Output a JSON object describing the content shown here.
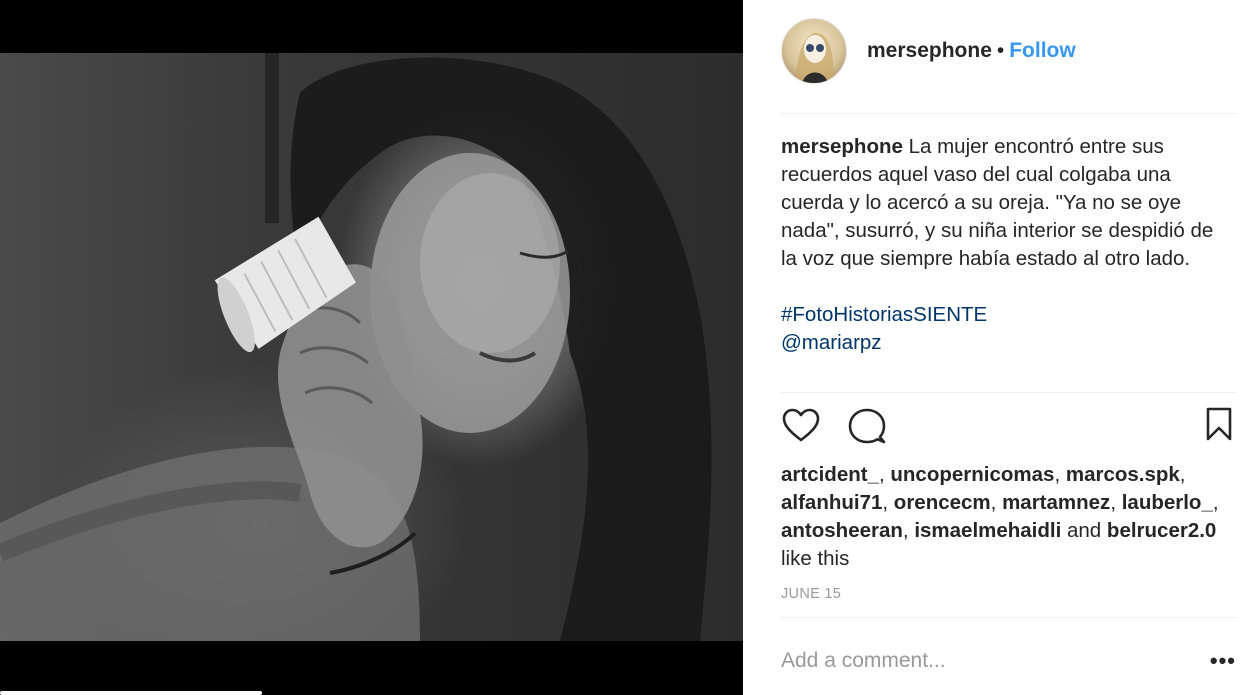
{
  "post": {
    "username": "mersephone",
    "separator": "•",
    "follow_label": "Follow",
    "avatar_icon": "user-avatar-icon",
    "image_icon": "photo-image",
    "caption": {
      "username": "mersephone",
      "text": "La mujer encontró entre sus recuerdos aquel vaso del cual colgaba una cuerda y lo acercó a su oreja. \"Ya no se oye nada\", susurró, y su niña interior se despidió de la voz que siempre había estado al otro lado.",
      "hashtag": "#FotoHistoriasSIENTE",
      "mention": "@mariarpz"
    },
    "actions": {
      "like_icon": "heart-icon",
      "comment_icon": "comment-icon",
      "save_icon": "bookmark-icon"
    },
    "likes": {
      "users_line1": [
        "artcident_",
        "uncopernicomas",
        "marcos.spk"
      ],
      "users_line2": [
        "alfanhui71",
        "orencecm",
        "martamnez",
        "lauberlo_"
      ],
      "users_line3": [
        "antosheeran",
        "ismaelmehaidli"
      ],
      "and_word": "and",
      "last_user": "belrucer2.0",
      "suffix": "like this",
      "comma": ","
    },
    "date": "JUNE 15",
    "comment": {
      "placeholder": "Add a comment...",
      "more_label": "•••"
    }
  },
  "colors": {
    "link": "#3897f0",
    "hashtag": "#003569",
    "muted": "#999999",
    "text": "#262626",
    "divider": "#efefef"
  }
}
